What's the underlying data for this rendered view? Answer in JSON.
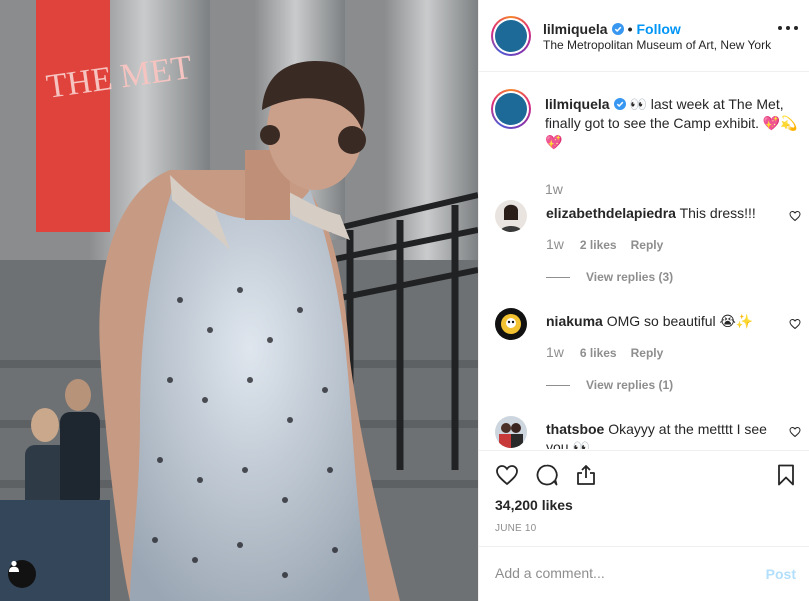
{
  "post": {
    "username": "lilmiquela",
    "follow_label": "Follow",
    "location": "The Metropolitan Museum of Art, New York",
    "caption": "👀 last week at The Met, finally got to see the Camp exhibit. 💖💫💖",
    "caption_time": "1w",
    "likes": "34,200 likes",
    "date": "JUNE 10"
  },
  "banner_text": "THE MET",
  "comments": [
    {
      "user": "elizabethdelapiedra",
      "text": "This dress!!!",
      "time": "1w",
      "likes": "2 likes",
      "reply": "Reply",
      "view_replies": "View replies (3)"
    },
    {
      "user": "niakuma",
      "text": "OMG so beautiful 😭✨",
      "time": "1w",
      "likes": "6 likes",
      "reply": "Reply",
      "view_replies": "View replies (1)"
    },
    {
      "user": "thatsboe",
      "text": "Okayyy at the metttt I see you 👀"
    }
  ],
  "add_comment": {
    "placeholder": "Add a comment...",
    "post_label": "Post"
  },
  "icons": [
    "verified-badge-icon",
    "more-options-icon",
    "heart-icon",
    "comment-icon",
    "share-icon",
    "bookmark-icon",
    "user-tag-icon"
  ],
  "colors": {
    "link_blue": "#0095f6",
    "post_disabled": "#b2dffc",
    "muted": "#8e8e8e"
  }
}
